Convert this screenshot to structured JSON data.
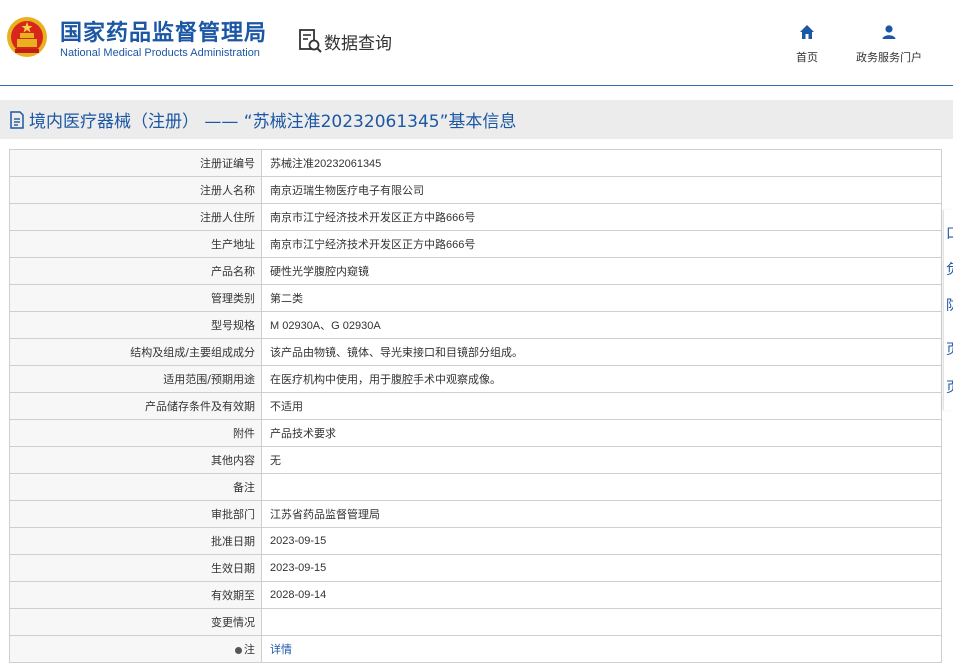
{
  "header": {
    "logo_cn": "国家药品监督管理局",
    "logo_en": "National Medical Products Administration",
    "query_label": "数据查询",
    "nav": [
      {
        "label": "首页",
        "icon": "home-icon"
      },
      {
        "label": "政务服务门户",
        "icon": "user-icon"
      }
    ]
  },
  "title": "境内医疗器械（注册）  ——  “苏械注准20232061345”基本信息",
  "rows": [
    {
      "label": "注册证编号",
      "value": "苏械注准20232061345"
    },
    {
      "label": "注册人名称",
      "value": "南京迈瑞生物医疗电子有限公司"
    },
    {
      "label": "注册人住所",
      "value": "南京市江宁经济技术开发区正方中路666号"
    },
    {
      "label": "生产地址",
      "value": "南京市江宁经济技术开发区正方中路666号"
    },
    {
      "label": "产品名称",
      "value": "硬性光学腹腔内窥镜"
    },
    {
      "label": "管理类别",
      "value": "第二类"
    },
    {
      "label": "型号规格",
      "value": "M 02930A、G 02930A"
    },
    {
      "label": "结构及组成/主要组成成分",
      "value": "该产品由物镜、镜体、导光束接口和目镜部分组成。"
    },
    {
      "label": "适用范围/预期用途",
      "value": "在医疗机构中使用，用于腹腔手术中观察成像。"
    },
    {
      "label": "产品储存条件及有效期",
      "value": "不适用"
    },
    {
      "label": "附件",
      "value": "产品技术要求"
    },
    {
      "label": "其他内容",
      "value": "无"
    },
    {
      "label": "备注",
      "value": ""
    },
    {
      "label": "审批部门",
      "value": "江苏省药品监督管理局"
    },
    {
      "label": "批准日期",
      "value": "2023-09-15"
    },
    {
      "label": "生效日期",
      "value": "2023-09-15"
    },
    {
      "label": "有效期至",
      "value": "2028-09-14"
    },
    {
      "label": "变更情况",
      "value": ""
    }
  ],
  "note_row": {
    "label": "注",
    "link": "详情"
  },
  "side_tabs": [
    "口",
    "负",
    "防",
    "页",
    "页"
  ],
  "colors": {
    "brand_blue": "#1c57a5",
    "title_bg": "#ececec",
    "label_bg": "#f7f7f7",
    "border": "#cfcfcf"
  }
}
